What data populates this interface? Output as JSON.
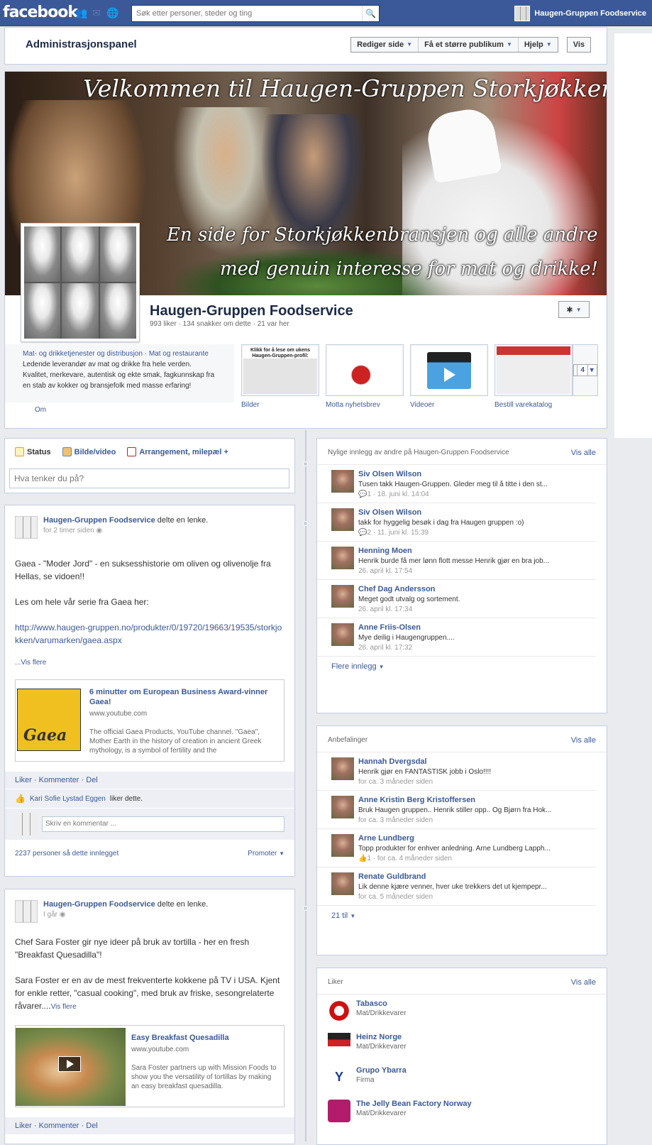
{
  "topbar": {
    "logo": "facebook",
    "search_placeholder": "Søk etter personer, steder og ting",
    "profile_name": "Haugen-Gruppen Foodservice"
  },
  "admin": {
    "title": "Administrasjonspanel",
    "buttons": [
      "Rediger side",
      "Få et større publikum",
      "Hjelp"
    ],
    "view": "Vis"
  },
  "cover": {
    "title": "Velkommen til Haugen-Gruppen Storkjøkken",
    "sub1": "En side for Storkjøkkenbransjen og alle andre",
    "sub2": "med genuin interesse for mat og drikke!"
  },
  "page": {
    "name": "Haugen-Gruppen Foodservice",
    "stats": "993 liker · 134 snakker om dette · 21 var her"
  },
  "about": {
    "categories": "Mat- og drikketjenester og distribusjon · Mat og restaurante",
    "description": "Ledende leverandør av mat og drikke fra hele verden. Kvalitet, merkevare, autentisk og ekte smak, fagkunnskap fra en stab av kokker og bransjefolk med masse erfaring!",
    "link": "Om"
  },
  "apps": [
    {
      "label": "Bilder",
      "caption": "Klikk for å lese om ukens Haugen-Gruppen-profil:"
    },
    {
      "label": "Motta nyhetsbrev"
    },
    {
      "label": "Videoer"
    },
    {
      "label": "Bestill varekatalog"
    }
  ],
  "apps_more": "4",
  "composer": {
    "tabs": [
      "Status",
      "Bilde/video",
      "Arrangement, milepæl +"
    ],
    "placeholder": "Hva tenker du på?"
  },
  "posts": [
    {
      "author": "Haugen-Gruppen Foodservice",
      "action": "delte en lenke.",
      "time": "for 2 timer siden",
      "p1": "Gaea - \"Moder Jord\" - en suksesshistorie om oliven og olivenolje fra Hellas, se vidoen!!",
      "p2": "Les om hele vår serie fra Gaea her:",
      "url": "http://www.haugen-gruppen.no/produkter/0/19720/19663/19535/storkjokken/varumarken/gaea.aspx",
      "more": "...Vis flere",
      "share_title": "6 minutter om European Business Award-vinner Gaea!",
      "share_src": "www.youtube.com",
      "share_desc": "The official Gaea Products, YouTube channel. \"Gaea\", Mother Earth in the history of creation in ancient Greek mythology, is a symbol of fertility and the",
      "actions": "Liker · Kommenter · Del",
      "liked_by": "Kari Sofie Lystad Eggen",
      "liked_suffix": "liker dette.",
      "comment_placeholder": "Skriv en kommentar ...",
      "seen": "2237 personer så dette innlegget",
      "promote": "Promoter"
    },
    {
      "author": "Haugen-Gruppen Foodservice",
      "action": "delte en lenke.",
      "time": "I går",
      "p1": "Chef Sara Foster gir nye ideer på bruk av tortilla - her en fresh \"Breakfast Quesadilla\"!",
      "p2": "Sara Foster er en av de mest frekventerte kokkene på TV i USA. Kjent for enkle retter, \"casual cooking\", med bruk av friske, sesongrelaterte råvarer....",
      "more": "Vis flere",
      "share_title": "Easy Breakfast Quesadilla",
      "share_src": "www.youtube.com",
      "share_desc": "Sara Foster partners up with Mission Foods to show you the versatility of tortillas by making an easy breakfast quesadilla.",
      "actions": "Liker · Kommenter · Del"
    }
  ],
  "recent": {
    "title": "Nylige innlegg av andre på Haugen-Gruppen Foodservice",
    "view_all": "Vis alle",
    "items": [
      {
        "name": "Siv Olsen Wilson",
        "text": "Tusen takk Haugen-Gruppen. Gleder meg til å titte i den st...",
        "meta": "1 · 18. juni kl. 14:04"
      },
      {
        "name": "Siv Olsen Wilson",
        "text": "takk for hyggelig besøk i dag fra Haugen gruppen :o)",
        "meta": "2 · 11. juni kl. 15:39"
      },
      {
        "name": "Henning Moen",
        "text": "Henrik burde få mer lønn flott messe Henrik gjør en bra job...",
        "meta": "26. april kl. 17:54"
      },
      {
        "name": "Chef Dag Andersson",
        "text": "Meget godt utvalg og sortement.",
        "meta": "26. april kl. 17:34"
      },
      {
        "name": "Anne Friis-Olsen",
        "text": "Mye deilig i Haugengruppen....",
        "meta": "26. april kl. 17:32"
      }
    ],
    "more": "Flere innlegg"
  },
  "recs": {
    "title": "Anbefalinger",
    "view_all": "Vis alle",
    "items": [
      {
        "name": "Hannah Dvergsdal",
        "text": "Henrik gjør en FANTASTISK jobb i Oslo!!!!",
        "meta": "for ca. 3 måneder siden"
      },
      {
        "name": "Anne Kristin Berg Kristoffersen",
        "text": "Bruk Haugen gruppen.. Henrik stiller opp.. Og Bjørn fra Hok...",
        "meta": "for ca. 3 måneder siden"
      },
      {
        "name": "Arne Lundberg",
        "text": "Topp produkter for enhver anledning. Arne Lundberg Lapph...",
        "meta": "1 · for ca. 4 måneder siden"
      },
      {
        "name": "Renate Guldbrand",
        "text": "Lik denne kjære venner, hver uke trekkers det ut kjempepr...",
        "meta": "for ca. 5 måneder siden"
      }
    ],
    "more": "21 til"
  },
  "likes": {
    "title": "Liker",
    "view_all": "Vis alle",
    "items": [
      {
        "name": "Tabasco",
        "cat": "Mat/Drikkevarer"
      },
      {
        "name": "Heinz Norge",
        "cat": "Mat/Drikkevarer"
      },
      {
        "name": "Grupo Ybarra",
        "cat": "Firma"
      },
      {
        "name": "The Jelly Bean Factory Norway",
        "cat": "Mat/Drikkevarer"
      }
    ]
  }
}
